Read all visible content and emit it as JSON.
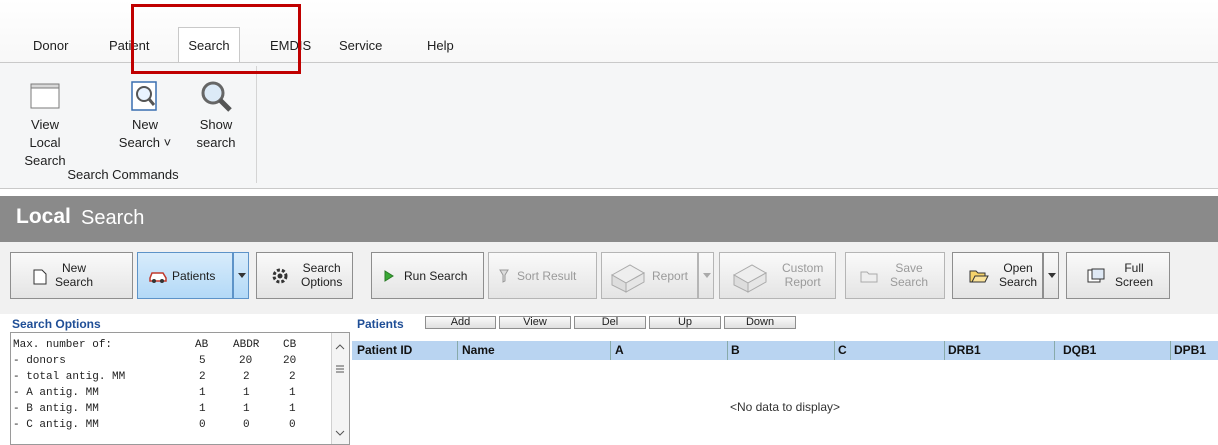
{
  "tabs": [
    "Donor",
    "Patient",
    "Search",
    "EMDIS",
    "Service",
    "Help"
  ],
  "ribbon": {
    "buttons": [
      {
        "line1": "View Local",
        "line2": "Search"
      },
      {
        "line1": "New",
        "line2": "Search ˅"
      },
      {
        "line1": "Show",
        "line2": "search"
      }
    ],
    "group_label": "Search Commands"
  },
  "header": {
    "title_bold": "Local",
    "title": "Search"
  },
  "toolbar": {
    "new_search": [
      "New",
      "Search"
    ],
    "patients": "Patients",
    "search_options": [
      "Search",
      "Options"
    ],
    "run_search": "Run Search",
    "sort_result": "Sort Result",
    "report": "Report",
    "custom_report": [
      "Custom",
      "Report"
    ],
    "save_search": [
      "Save",
      "Search"
    ],
    "open_search": [
      "Open",
      "Search"
    ],
    "full_screen": [
      "Full",
      "Screen"
    ]
  },
  "search_options": {
    "label": "Search Options",
    "header": "Max. number of:",
    "columns": [
      "AB",
      "ABDR",
      "CB"
    ],
    "rows": [
      {
        "label": "- donors",
        "values": [
          "5",
          "20",
          "20"
        ]
      },
      {
        "label": "- total antig. MM",
        "values": [
          "2",
          "2",
          "2"
        ]
      },
      {
        "label": "- A antig. MM",
        "values": [
          "1",
          "1",
          "1"
        ]
      },
      {
        "label": "- B antig. MM",
        "values": [
          "1",
          "1",
          "1"
        ]
      },
      {
        "label": "- C antig. MM",
        "values": [
          "0",
          "0",
          "0"
        ]
      }
    ]
  },
  "patients": {
    "label": "Patients",
    "buttons": [
      "Add",
      "View",
      "Del",
      "Up",
      "Down"
    ],
    "columns": [
      "Patient ID",
      "Name",
      "A",
      "B",
      "C",
      "DRB1",
      "DQB1",
      "DPB1"
    ],
    "empty_text": "<No data to display>"
  },
  "colors": {
    "accent_red": "#c00000",
    "header_gray": "#8a8a8a",
    "grid_header": "#b9d4f1"
  }
}
